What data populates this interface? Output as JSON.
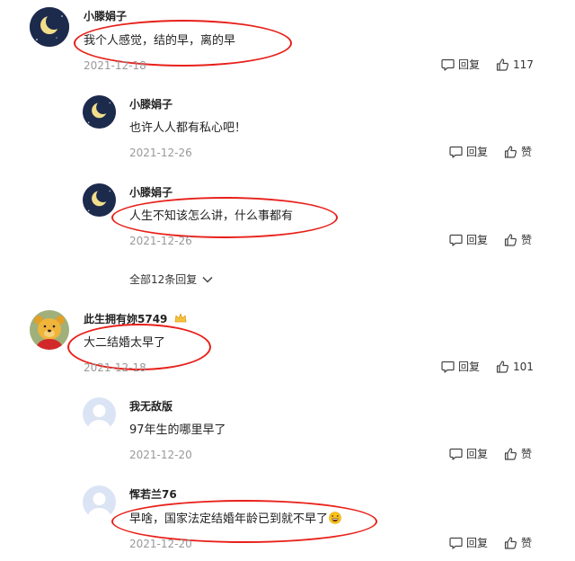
{
  "comments": [
    {
      "user": "小滕娟子",
      "avatar_icon": "crescent-moon-avatar",
      "text": "我个人感觉，结的早，离的早",
      "date": "2021-12-18",
      "reply_label": "回复",
      "like_label": "117",
      "replies": [
        {
          "user": "小滕娟子",
          "avatar_icon": "crescent-moon-avatar",
          "text": "也许人人都有私心吧！",
          "date": "2021-12-26",
          "reply_label": "回复",
          "like_label": "赞"
        },
        {
          "user": "小滕娟子",
          "avatar_icon": "crescent-moon-avatar",
          "text": "人生不知该怎么讲，什么事都有",
          "date": "2021-12-26",
          "reply_label": "回复",
          "like_label": "赞"
        }
      ],
      "more_replies_label": "全部12条回复"
    },
    {
      "user": "此生拥有妳5749",
      "badge_icon": "crown-icon",
      "avatar_icon": "winnie-the-pooh-avatar",
      "text": "大二结婚太早了",
      "date": "2021-12-18",
      "reply_label": "回复",
      "like_label": "101",
      "replies": [
        {
          "user": "我无敌版",
          "avatar_icon": "default-user-avatar",
          "text": "97年生的哪里早了",
          "date": "2021-12-20",
          "reply_label": "回复",
          "like_label": "赞"
        },
        {
          "user": "恽若兰76",
          "avatar_icon": "default-user-avatar",
          "text": "早啥，国家法定结婚年龄已到就不早了",
          "text_emoji_icon": "laughing-emoji-icon",
          "date": "2021-12-20",
          "reply_label": "回复",
          "like_label": "赞"
        }
      ]
    }
  ],
  "colors": {
    "highlight_ring": "#e8201a",
    "date_text": "#999999",
    "avatar_night": "#1c2a4c",
    "moon": "#f2de8a",
    "default_avatar": "#dbe4f4"
  }
}
